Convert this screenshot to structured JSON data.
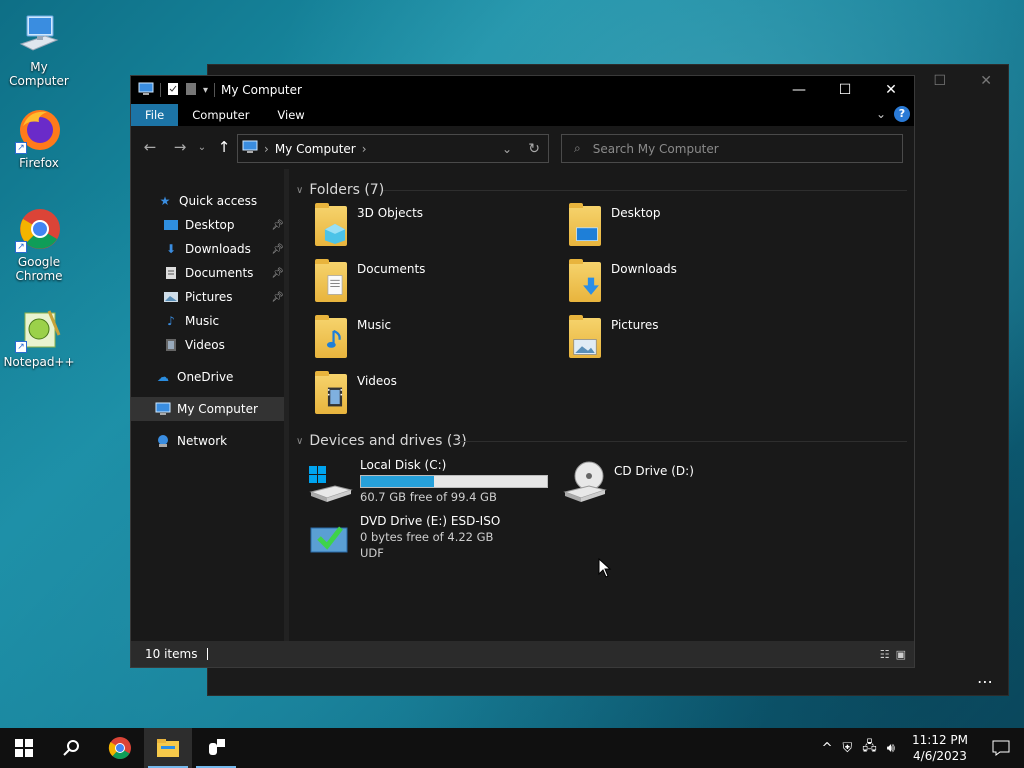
{
  "desktop": {
    "icons": [
      {
        "label": "My Computer"
      },
      {
        "label": "Firefox"
      },
      {
        "label": "Google Chrome"
      },
      {
        "label": "Notepad++"
      }
    ]
  },
  "window": {
    "title": "My Computer",
    "ribbon_tabs": [
      "File",
      "Computer",
      "View"
    ],
    "address": {
      "crumb": "My Computer"
    },
    "search": {
      "placeholder": "Search My Computer"
    },
    "sidebar": [
      {
        "label": "Quick access"
      },
      {
        "label": "Desktop"
      },
      {
        "label": "Downloads"
      },
      {
        "label": "Documents"
      },
      {
        "label": "Pictures"
      },
      {
        "label": "Music"
      },
      {
        "label": "Videos"
      },
      {
        "label": "OneDrive"
      },
      {
        "label": "My Computer"
      },
      {
        "label": "Network"
      }
    ],
    "folders_header": "Folders (7)",
    "folders": [
      {
        "label": "3D Objects"
      },
      {
        "label": "Desktop"
      },
      {
        "label": "Documents"
      },
      {
        "label": "Downloads"
      },
      {
        "label": "Music"
      },
      {
        "label": "Pictures"
      },
      {
        "label": "Videos"
      }
    ],
    "devices_header": "Devices and drives (3)",
    "drives": [
      {
        "label": "Local Disk (C:)",
        "detail": "60.7 GB free of 99.4 GB",
        "used_fraction": 0.39
      },
      {
        "label": "CD Drive (D:)"
      },
      {
        "label": "DVD Drive (E:) ESD-ISO",
        "detail": "0 bytes free of 4.22 GB",
        "detail2": "UDF"
      }
    ],
    "status": {
      "items": "10 items"
    }
  },
  "taskbar": {
    "time": "11:12 PM",
    "date": "4/6/2023"
  },
  "colors": {
    "accent": "#1c74a6",
    "drive_fill": "#26a0da"
  }
}
